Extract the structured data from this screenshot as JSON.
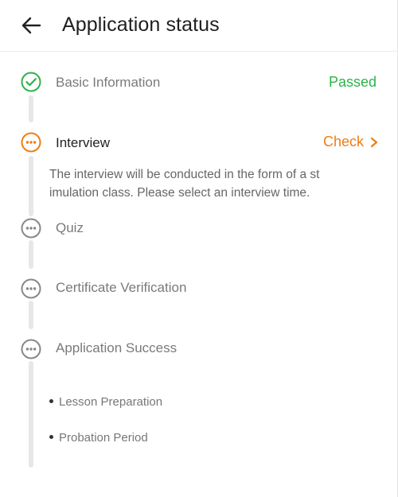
{
  "header": {
    "title": "Application status",
    "back_icon": "arrow-left-icon"
  },
  "colors": {
    "passed": "#2db34a",
    "active": "#f07d14",
    "pending": "#888888",
    "track": "#e7e7e7"
  },
  "steps": [
    {
      "label": "Basic Information",
      "status": "Passed",
      "state": "passed",
      "icon": "check-circle-icon"
    },
    {
      "label": "Interview",
      "action": "Check",
      "state": "active",
      "icon": "more-circle-icon",
      "description": "The interview will be conducted in the form of a st imulation class. Please select an interview time."
    },
    {
      "label": "Quiz",
      "state": "pending",
      "icon": "more-circle-icon"
    },
    {
      "label": "Certificate Verification",
      "state": "pending",
      "icon": "more-circle-icon"
    },
    {
      "label": "Application Success",
      "state": "pending",
      "icon": "more-circle-icon",
      "sub_items": [
        "Lesson Preparation",
        "Probation Period"
      ]
    }
  ]
}
